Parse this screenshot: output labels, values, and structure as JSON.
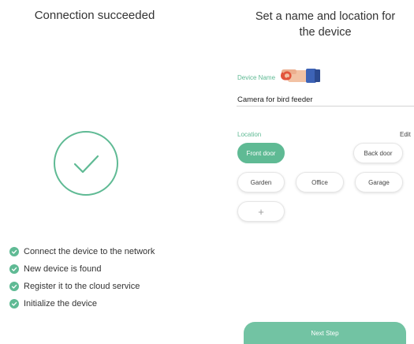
{
  "left_screen": {
    "title": "Connection succeeded",
    "steps": [
      "Connect the device to the  network",
      "New device is found",
      "Register it to the cloud service",
      "Initialize the device"
    ]
  },
  "right_screen": {
    "title_line1": "Set a name and location for",
    "title_line2": "the device",
    "device_name_label": "Device Name",
    "device_name_value": "Camera for bird feeder",
    "location_label": "Location",
    "edit_label": "Edit",
    "locations": [
      "Front door",
      "Back door",
      "Garden",
      "Office",
      "Garage"
    ],
    "selected_location": "Front door",
    "add_label": "+",
    "next_label": "Next Step"
  },
  "colors": {
    "accent": "#5fba94",
    "button": "#72c3a3"
  },
  "icons": {
    "success": "checkmark-circle-icon",
    "step": "check-dot-icon",
    "hint": "pointing-hand-icon"
  }
}
